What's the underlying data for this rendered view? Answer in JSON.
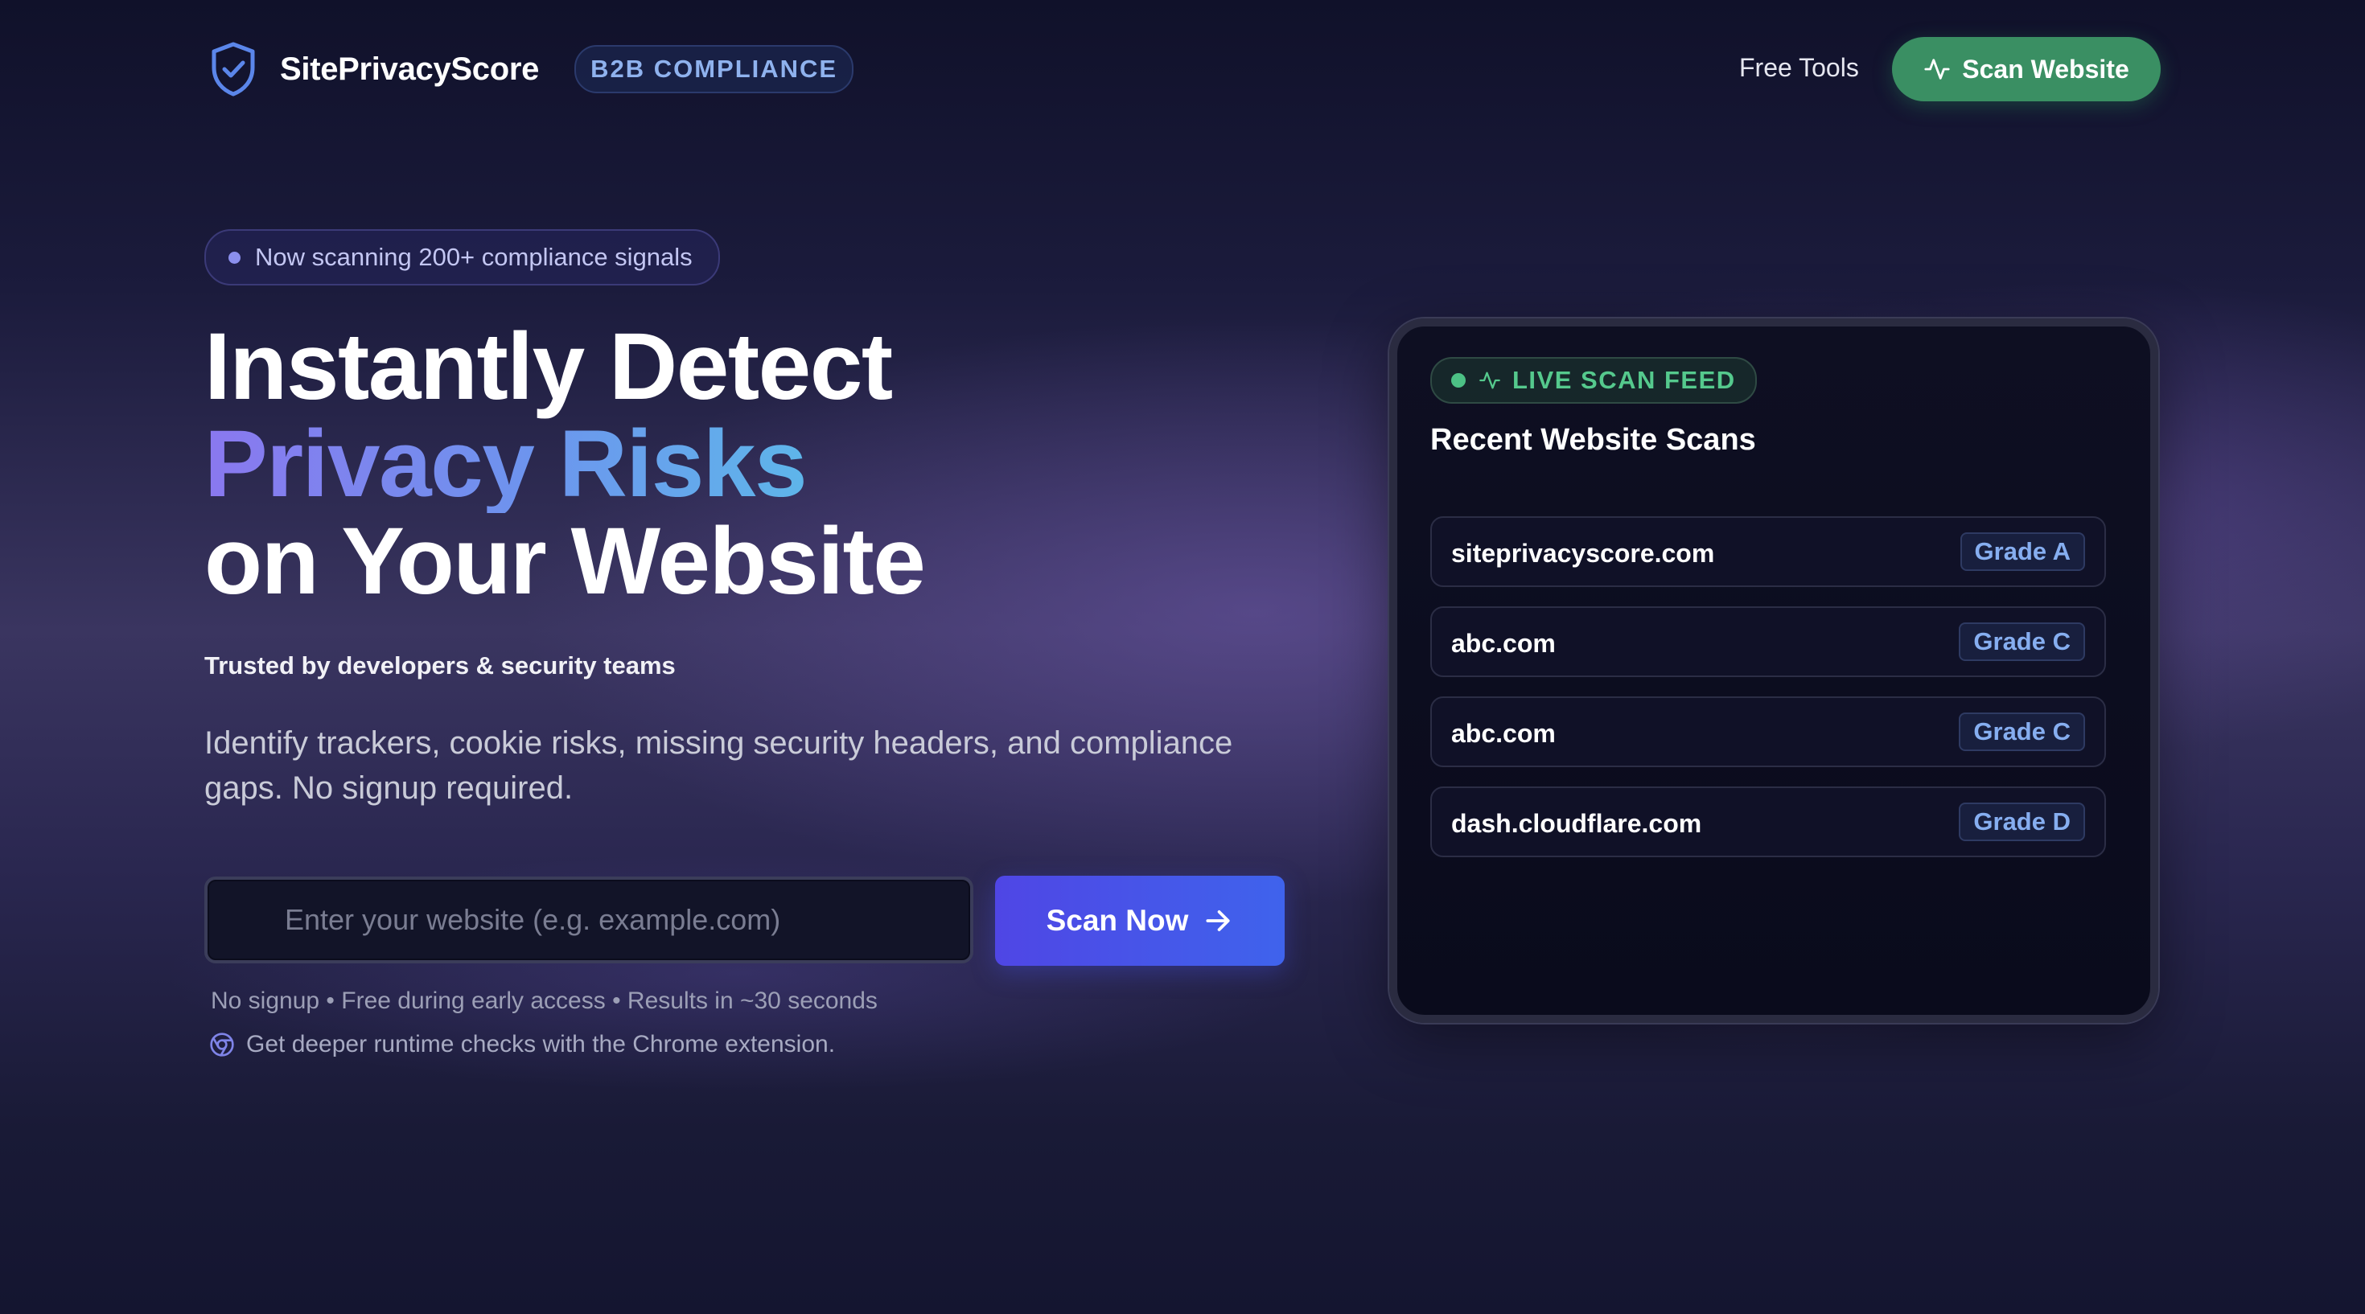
{
  "header": {
    "brand_name": "SitePrivacyScore",
    "brand_badge": "B2B COMPLIANCE",
    "brand_icon": "shield-check-icon",
    "nav_link": "Free Tools",
    "cta_label": "Scan Website",
    "cta_icon": "activity-icon"
  },
  "hero": {
    "pill_text": "Now scanning 200+ compliance signals",
    "headline_line1": "Instantly Detect",
    "headline_line2": "Privacy Risks",
    "headline_line3": "on Your Website",
    "trusted": "Trusted by developers & security teams",
    "description": "Identify trackers, cookie risks, missing security headers, and compliance gaps. No signup required.",
    "input_placeholder": "Enter your website (e.g. example.com)",
    "input_value": "",
    "scan_button": "Scan Now",
    "note": "No signup • Free during early access • Results in ~30 seconds",
    "extension_text": "Get deeper runtime checks with the Chrome extension."
  },
  "feed": {
    "badge": "LIVE SCAN FEED",
    "title": "Recent Website Scans",
    "rows": [
      {
        "domain": "siteprivacyscore.com",
        "grade": "Grade A"
      },
      {
        "domain": "abc.com",
        "grade": "Grade C"
      },
      {
        "domain": "abc.com",
        "grade": "Grade C"
      },
      {
        "domain": "dash.cloudflare.com",
        "grade": "Grade D"
      }
    ]
  },
  "colors": {
    "accent_green": "#3a8f63",
    "accent_indigo": "#4f46e5",
    "grade_text": "#86aef0",
    "live_green": "#55c98d"
  }
}
